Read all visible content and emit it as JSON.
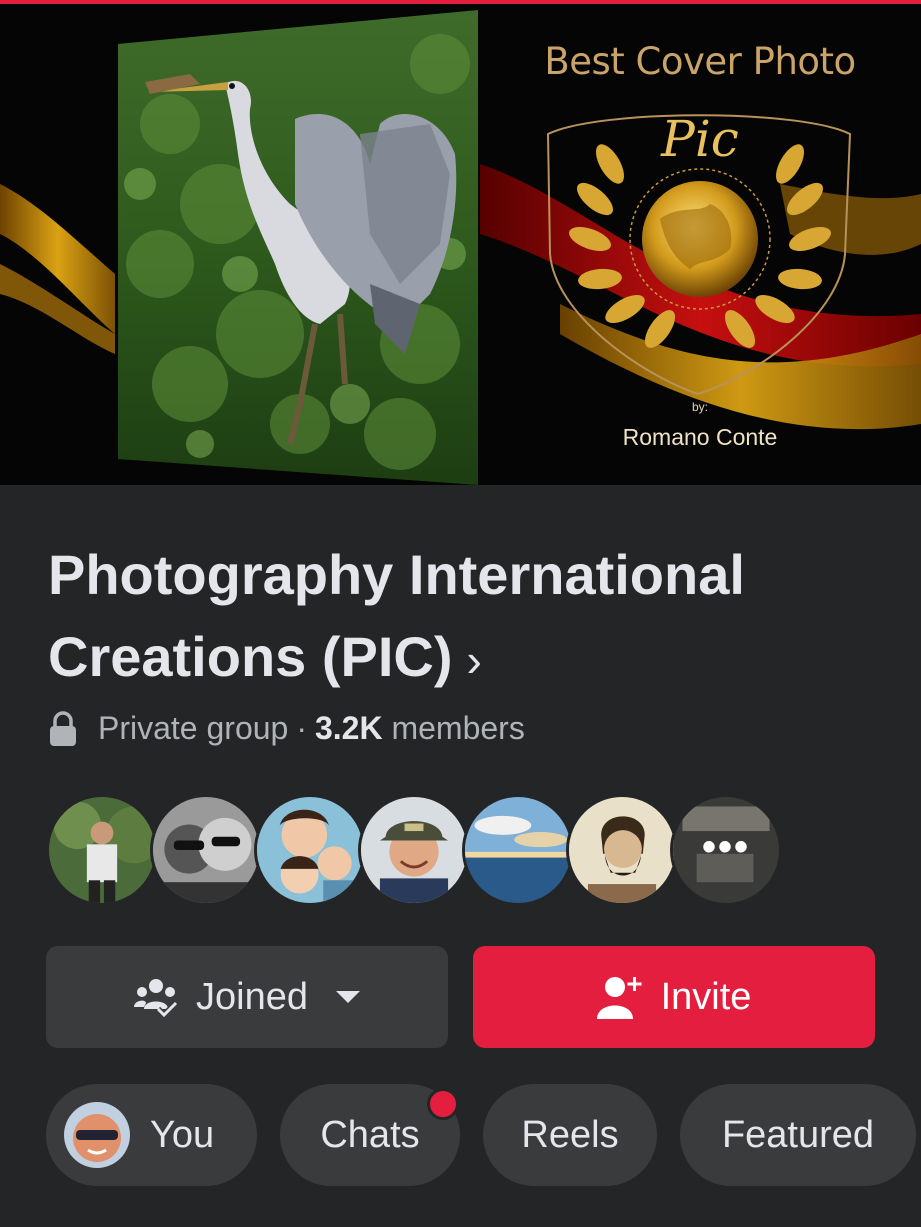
{
  "colors": {
    "accent": "#e41e3f",
    "background": "#242526",
    "button_bg": "#3a3b3c",
    "gold": "#c9a36a"
  },
  "cover": {
    "title": "Best Cover Photo",
    "by": "by:",
    "author": "Romano Conte",
    "logo_text": "Pic"
  },
  "group": {
    "name": "Photography International Creations (PIC)",
    "chevron": "›",
    "privacy": "Private group",
    "separator": "·",
    "member_count": "3.2K",
    "members_label": "members"
  },
  "avatars": {
    "more_label": "•••"
  },
  "actions": {
    "joined_label": "Joined",
    "invite_label": "Invite"
  },
  "tabs": {
    "you": "You",
    "chats": "Chats",
    "reels": "Reels",
    "featured": "Featured"
  }
}
